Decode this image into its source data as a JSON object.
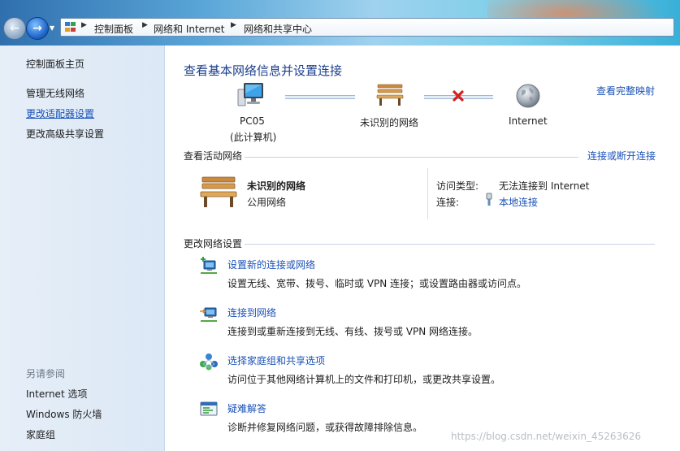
{
  "address_bar": {
    "breadcrumbs": [
      "控制面板",
      "网络和 Internet",
      "网络和共享中心"
    ]
  },
  "sidebar": {
    "items": [
      {
        "label": "控制面板主页"
      },
      {
        "label": "管理无线网络"
      },
      {
        "label": "更改适配器设置"
      },
      {
        "label": "更改高级共享设置"
      }
    ],
    "see_also_title": "另请参阅",
    "see_also": [
      {
        "label": "Internet 选项"
      },
      {
        "label": "Windows 防火墙"
      },
      {
        "label": "家庭组"
      }
    ]
  },
  "main": {
    "title": "查看基本网络信息并设置连接",
    "full_map_link": "查看完整映射",
    "map": {
      "computer_name": "PC05",
      "computer_note": "(此计算机)",
      "network_name": "未识别的网络",
      "internet_label": "Internet"
    },
    "active_networks": {
      "heading": "查看活动网络",
      "connect_link": "连接或断开连接",
      "network_name": "未识别的网络",
      "network_type": "公用网络",
      "access_type_label": "访问类型:",
      "access_type_value": "无法连接到 Internet",
      "connections_label": "连接:",
      "connections_value": "本地连接"
    },
    "change_settings": {
      "heading": "更改网络设置",
      "tasks": [
        {
          "link": "设置新的连接或网络",
          "desc": "设置无线、宽带、拨号、临时或 VPN 连接；或设置路由器或访问点。",
          "icon": "new-connection-icon"
        },
        {
          "link": "连接到网络",
          "desc": "连接到或重新连接到无线、有线、拨号或 VPN 网络连接。",
          "icon": "connect-network-icon"
        },
        {
          "link": "选择家庭组和共享选项",
          "desc": "访问位于其他网络计算机上的文件和打印机，或更改共享设置。",
          "icon": "homegroup-icon"
        },
        {
          "link": "疑难解答",
          "desc": "诊断并修复网络问题，或获得故障排除信息。",
          "icon": "troubleshoot-icon"
        }
      ]
    }
  },
  "watermark": "https://blog.csdn.net/weixin_45263626"
}
